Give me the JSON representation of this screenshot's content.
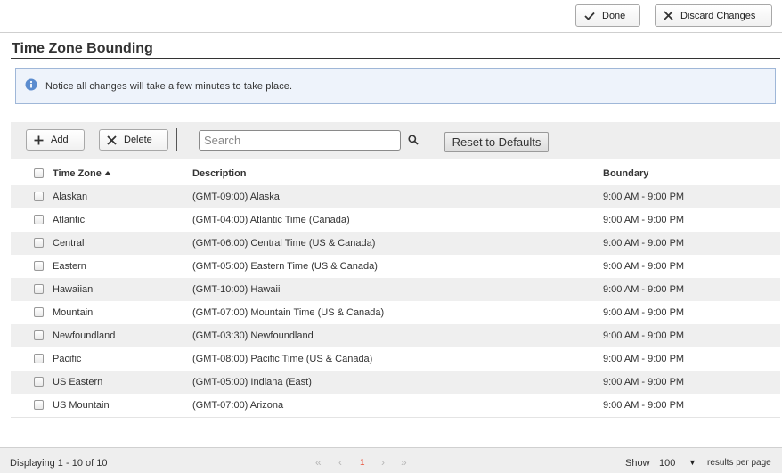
{
  "header": {
    "done_label": "Done",
    "discard_label": "Discard Changes"
  },
  "page": {
    "title": "Time Zone Bounding",
    "notice": "Notice all changes will take a few minutes to take place."
  },
  "toolbar": {
    "add_label": "Add",
    "delete_label": "Delete",
    "search_placeholder": "Search",
    "search_value": "",
    "reset_label": "Reset to Defaults"
  },
  "grid": {
    "columns": [
      "Time Zone",
      "Description",
      "Boundary"
    ],
    "rows": [
      {
        "zone": "Alaskan",
        "description": "(GMT-09:00) Alaska",
        "boundary": "9:00 AM - 9:00 PM"
      },
      {
        "zone": "Atlantic",
        "description": "(GMT-04:00) Atlantic Time (Canada)",
        "boundary": "9:00 AM - 9:00 PM"
      },
      {
        "zone": "Central",
        "description": "(GMT-06:00) Central Time (US & Canada)",
        "boundary": "9:00 AM - 9:00 PM"
      },
      {
        "zone": "Eastern",
        "description": "(GMT-05:00) Eastern Time (US & Canada)",
        "boundary": "9:00 AM - 9:00 PM"
      },
      {
        "zone": "Hawaiian",
        "description": "(GMT-10:00) Hawaii",
        "boundary": "9:00 AM - 9:00 PM"
      },
      {
        "zone": "Mountain",
        "description": "(GMT-07:00) Mountain Time (US & Canada)",
        "boundary": "9:00 AM - 9:00 PM"
      },
      {
        "zone": "Newfoundland",
        "description": "(GMT-03:30) Newfoundland",
        "boundary": "9:00 AM - 9:00 PM"
      },
      {
        "zone": "Pacific",
        "description": "(GMT-08:00) Pacific Time (US & Canada)",
        "boundary": "9:00 AM - 9:00 PM"
      },
      {
        "zone": "US Eastern",
        "description": "(GMT-05:00) Indiana (East)",
        "boundary": "9:00 AM - 9:00 PM"
      },
      {
        "zone": "US Mountain",
        "description": "(GMT-07:00) Arizona",
        "boundary": "9:00 AM - 9:00 PM"
      }
    ]
  },
  "footer": {
    "displaying": "Displaying 1 - 10 of 10",
    "pager": {
      "first": "«",
      "prev": "‹",
      "current": "1",
      "next": "›",
      "last": "»"
    },
    "show_label": "Show",
    "per_page": "100",
    "per_page_arrow": "▼",
    "results_label": "results per page"
  },
  "icons": {
    "done": "check-icon",
    "discard": "close-icon",
    "add": "plus-icon",
    "delete": "close-icon",
    "search": "search-icon",
    "notice": "info-icon",
    "sort": "sort-ascending-icon"
  },
  "colors": {
    "notice_bg": "#eef3fb",
    "notice_border": "#9fb7d8",
    "info_icon": "#5b8ccf",
    "row_alt": "#efefef",
    "pager_current": "#e8533c"
  }
}
